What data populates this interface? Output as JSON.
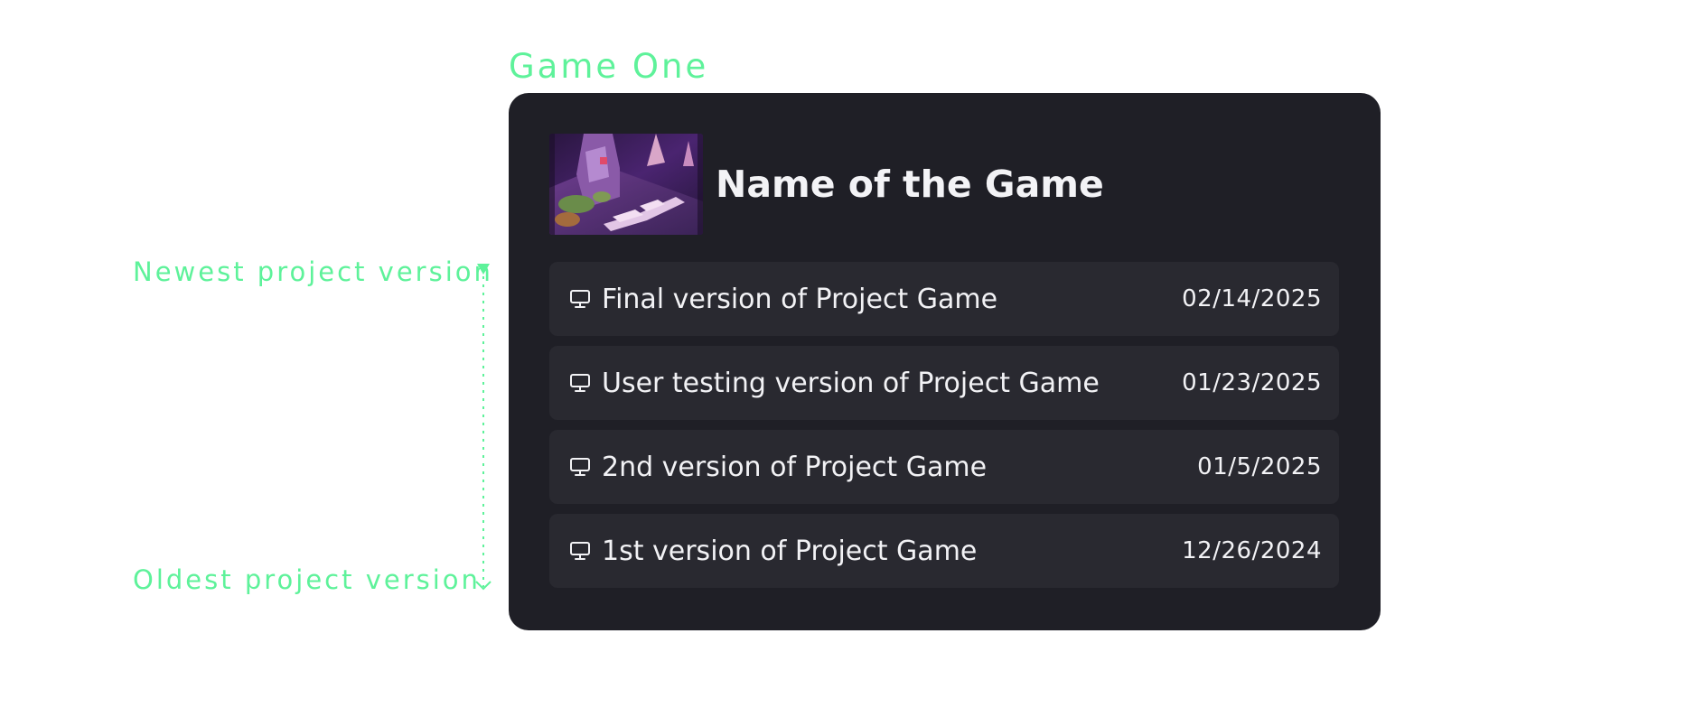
{
  "section": {
    "title": "Game One"
  },
  "annotations": {
    "newest": "Newest project version",
    "oldest": "Oldest project version"
  },
  "game": {
    "name": "Name of the Game",
    "thumbnail_icon": "game-thumbnail-image"
  },
  "versions": [
    {
      "label": "Final version of Project Game",
      "date": "02/14/2025",
      "icon": "monitor-icon"
    },
    {
      "label": "User testing version of Project Game",
      "date": "01/23/2025",
      "icon": "monitor-icon"
    },
    {
      "label": "2nd version of Project Game",
      "date": "01/5/2025",
      "icon": "monitor-icon"
    },
    {
      "label": "1st version of Project Game",
      "date": "12/26/2024",
      "icon": "monitor-icon"
    }
  ],
  "colors": {
    "accent": "#5ef29a",
    "card_bg": "#1f1f26",
    "row_bg": "#292930",
    "text": "#f2f2f5"
  }
}
